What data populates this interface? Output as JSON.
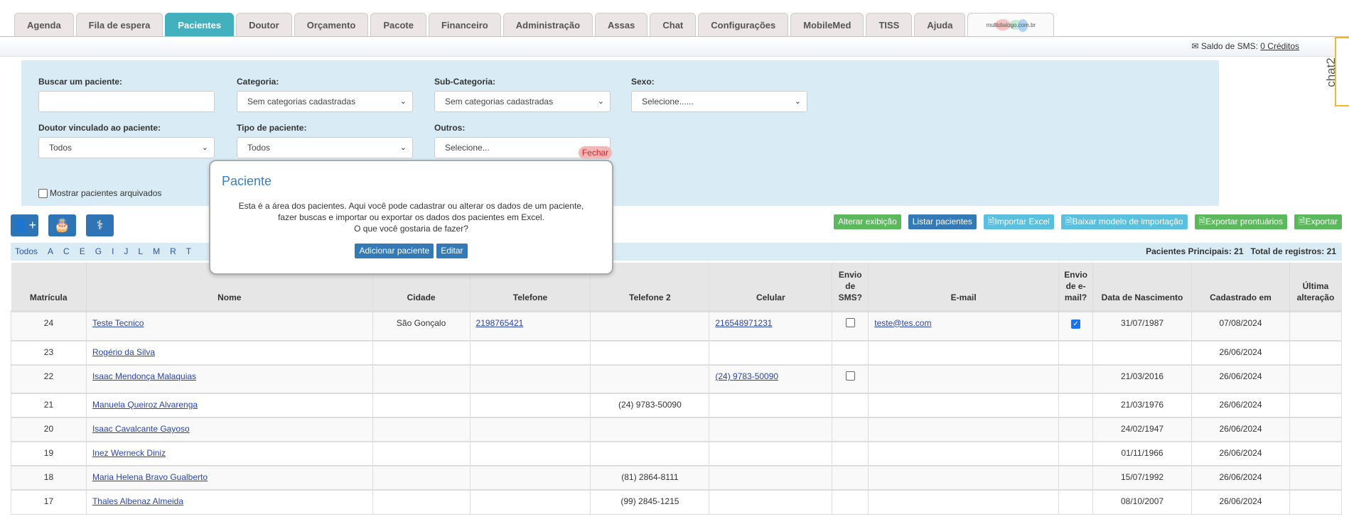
{
  "tabs": [
    "Agenda",
    "Fila de espera",
    "Pacientes",
    "Doutor",
    "Orçamento",
    "Pacote",
    "Financeiro",
    "Administração",
    "Assas",
    "Chat",
    "Configurações",
    "MobileMed",
    "TISS",
    "Ajuda"
  ],
  "active_tab": "Pacientes",
  "logo_text": "multidialogo.com.br",
  "sms": {
    "label": "Saldo de SMS:",
    "credits": "0 Créditos"
  },
  "chat_widget": "chat2",
  "filters": {
    "search": {
      "label": "Buscar um paciente:",
      "value": ""
    },
    "categoria": {
      "label": "Categoria:",
      "value": "Sem categorias cadastradas"
    },
    "subcategoria": {
      "label": "Sub-Categoria:",
      "value": "Sem categorias cadastradas"
    },
    "sexo": {
      "label": "Sexo:",
      "value": "Selecione......"
    },
    "doutor": {
      "label": "Doutor vinculado ao paciente:",
      "value": "Todos"
    },
    "tipo": {
      "label": "Tipo de paciente:",
      "value": "Todos"
    },
    "outros": {
      "label": "Outros:",
      "value": "Selecione..."
    },
    "archived": "Mostrar pacientes arquivados"
  },
  "actions": [
    "Alterar exibição",
    "Listar pacientes",
    "Importar Excel",
    "Baixar modelo de importação",
    "Exportar prontuários",
    "Exportar"
  ],
  "letters": [
    "Todos",
    "A",
    "C",
    "E",
    "G",
    "I",
    "J",
    "L",
    "M",
    "R",
    "T"
  ],
  "totals": "Pacientes Principais: 21   Total de registros: 21",
  "popup": {
    "title": "Paciente",
    "line1": "Esta é a área dos pacientes. Aqui você pode cadastrar ou alterar os dados de um paciente,",
    "line2": "fazer buscas e importar ou exportar os dados dos pacientes em Excel.",
    "line3": "O que você gostaria de fazer?",
    "add": "Adicionar paciente",
    "edit": "Editar",
    "close": "Fechar"
  },
  "table": {
    "headers": [
      "Matrícula",
      "Nome",
      "Cidade",
      "Telefone",
      "Telefone 2",
      "Celular",
      "Envio de SMS?",
      "E-mail",
      "Envio de e-mail?",
      "Data de Nascimento",
      "Cadastrado em",
      "Última alteração"
    ],
    "rows": [
      {
        "matricula": "24",
        "nome": "Teste Tecnico",
        "cidade": "São Gonçalo",
        "telefone": "2198765421",
        "telefone2": "",
        "celular": "216548971231",
        "sms": false,
        "email": "teste@tes.com",
        "envio_email": true,
        "nascimento": "31/07/1987",
        "cadastro": "07/08/2024",
        "alteracao": ""
      },
      {
        "matricula": "23",
        "nome": "Rogério da Silva",
        "cidade": "",
        "telefone": "",
        "telefone2": "",
        "celular": "",
        "sms": null,
        "email": "",
        "envio_email": null,
        "nascimento": "",
        "cadastro": "26/06/2024",
        "alteracao": ""
      },
      {
        "matricula": "22",
        "nome": "Isaac Mendonça Malaquias",
        "cidade": "",
        "telefone": "",
        "telefone2": "",
        "celular": "(24) 9783-50090",
        "sms": false,
        "email": "",
        "envio_email": null,
        "nascimento": "21/03/2016",
        "cadastro": "26/06/2024",
        "alteracao": ""
      },
      {
        "matricula": "21",
        "nome": "Manuela Queiroz Alvarenga",
        "cidade": "",
        "telefone": "",
        "telefone2": "(24) 9783-50090",
        "celular": "",
        "sms": null,
        "email": "",
        "envio_email": null,
        "nascimento": "21/03/1976",
        "cadastro": "26/06/2024",
        "alteracao": ""
      },
      {
        "matricula": "20",
        "nome": "Isaac Cavalcante Gayoso",
        "cidade": "",
        "telefone": "",
        "telefone2": "",
        "celular": "",
        "sms": null,
        "email": "",
        "envio_email": null,
        "nascimento": "24/02/1947",
        "cadastro": "26/06/2024",
        "alteracao": ""
      },
      {
        "matricula": "19",
        "nome": "Inez Werneck Diniz",
        "cidade": "",
        "telefone": "",
        "telefone2": "",
        "celular": "",
        "sms": null,
        "email": "",
        "envio_email": null,
        "nascimento": "01/11/1966",
        "cadastro": "26/06/2024",
        "alteracao": ""
      },
      {
        "matricula": "18",
        "nome": "Maria Helena Bravo Gualberto",
        "cidade": "",
        "telefone": "",
        "telefone2": "(81) 2864-8111",
        "celular": "",
        "sms": null,
        "email": "",
        "envio_email": null,
        "nascimento": "15/07/1992",
        "cadastro": "26/06/2024",
        "alteracao": ""
      },
      {
        "matricula": "17",
        "nome": "Thales Albenaz Almeida",
        "cidade": "",
        "telefone": "",
        "telefone2": "(99) 2845-1215",
        "celular": "",
        "sms": null,
        "email": "",
        "envio_email": null,
        "nascimento": "08/10/2007",
        "cadastro": "26/06/2024",
        "alteracao": ""
      }
    ]
  }
}
